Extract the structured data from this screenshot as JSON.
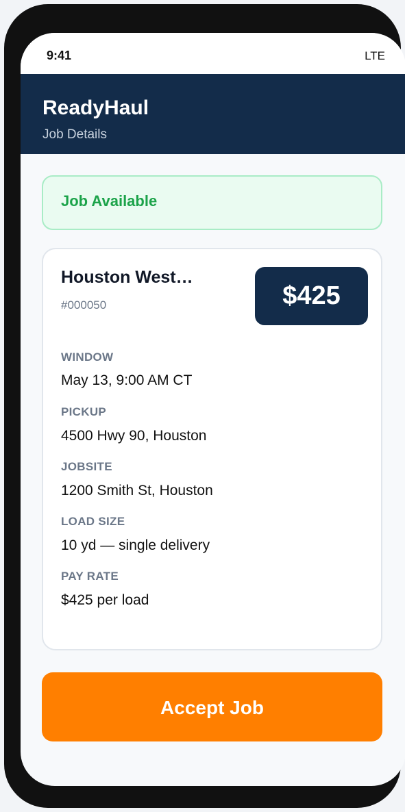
{
  "status_bar": {
    "time": "9:41",
    "network": "LTE"
  },
  "header": {
    "title": "ReadyHaul",
    "subtitle": "Job Details"
  },
  "banner": {
    "text": "Job Available"
  },
  "job": {
    "title": "Houston West…",
    "id": "#000050",
    "price": "$425",
    "details": [
      {
        "label": "WINDOW",
        "value": "May 13, 9:00 AM CT"
      },
      {
        "label": "PICKUP",
        "value": "4500 Hwy 90, Houston"
      },
      {
        "label": "JOBSITE",
        "value": "1200 Smith St, Houston"
      },
      {
        "label": "LOAD SIZE",
        "value": "10 yd — single delivery"
      },
      {
        "label": "PAY RATE",
        "value": "$425 per load"
      }
    ]
  },
  "actions": {
    "accept_label": "Accept Job"
  },
  "colors": {
    "header_bg": "#132c4a",
    "accent_orange": "#ff7f00",
    "success_green": "#1ca34a"
  }
}
